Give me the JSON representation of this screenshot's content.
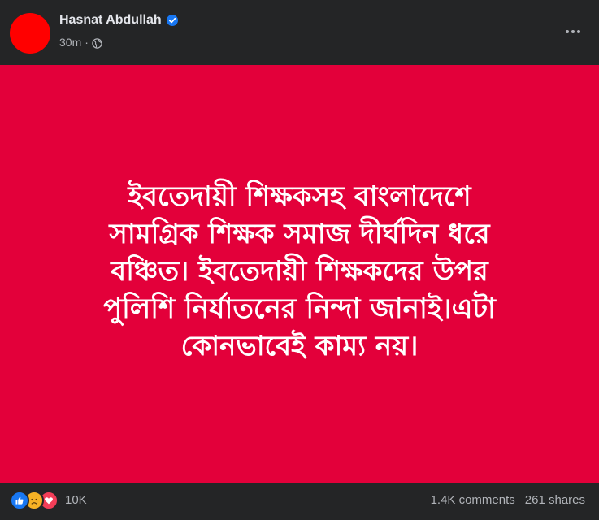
{
  "post": {
    "author": "Hasnat Abdullah",
    "time": "30m",
    "separator": "·",
    "privacy_icon": "globe-icon",
    "verified_icon": "verified-badge-icon",
    "avatar_color": "#ff0000"
  },
  "banner": {
    "background": "#e3003a",
    "lines": [
      "ইবতেদায়ী শিক্ষকসহ বাংলাদেশে",
      "সামগ্রিক শিক্ষক সমাজ দীর্ঘদিন ধরে",
      "বঞ্চিত। ইবতেদায়ী শিক্ষকদের উপর",
      "পুলিশি নির্যাতনের নিন্দা জানাই।এটা",
      "কোনভাবেই কাম্য নয়।"
    ]
  },
  "footer": {
    "reactions": [
      "like-icon",
      "sad-icon",
      "love-icon"
    ],
    "reaction_count": "10K",
    "comments": "1.4K comments",
    "shares": "261 shares"
  },
  "colors": {
    "background": "#242526",
    "text_primary": "#e4e6eb",
    "text_secondary": "#b0b3b8",
    "verified": "#1877f2"
  }
}
